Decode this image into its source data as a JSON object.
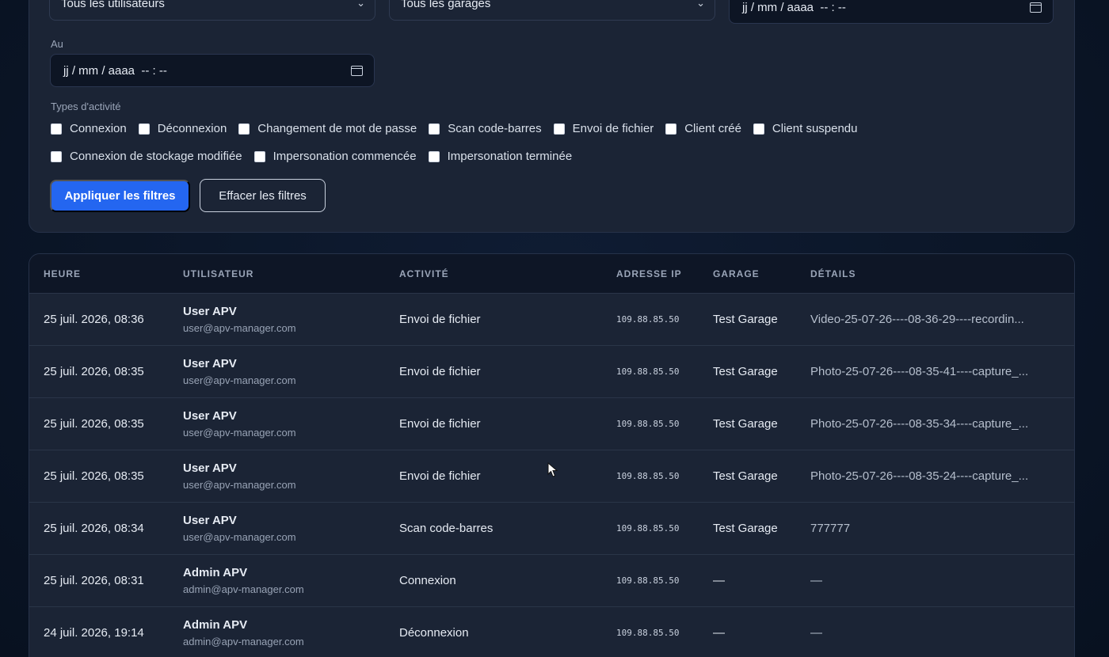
{
  "filters": {
    "user_select": "Tous les utilisateurs",
    "garage_select": "Tous les garages",
    "date_from": "jj / mm / aaaa  -- : --",
    "date_to_label": "Au",
    "date_to": "jj / mm / aaaa  -- : --",
    "types_label": "Types d'activité",
    "types_row1": [
      "Connexion",
      "Déconnexion",
      "Changement de mot de passe",
      "Scan code-barres",
      "Envoi de fichier",
      "Client créé",
      "Client suspendu"
    ],
    "types_row2": [
      "Connexion de stockage modifiée",
      "Impersonation commencée",
      "Impersonation terminée"
    ],
    "apply_label": "Appliquer les filtres",
    "clear_label": "Effacer les filtres"
  },
  "table": {
    "headers": [
      "HEURE",
      "UTILISATEUR",
      "ACTIVITÉ",
      "ADRESSE IP",
      "GARAGE",
      "DÉTAILS"
    ],
    "rows": [
      {
        "time": "25 juil. 2026, 08:36",
        "user": "User APV",
        "email": "user@apv-manager.com",
        "activity": "Envoi de fichier",
        "ip": "109.88.85.50",
        "garage": "Test Garage",
        "details": "Video-25-07-26----08-36-29----recordin..."
      },
      {
        "time": "25 juil. 2026, 08:35",
        "user": "User APV",
        "email": "user@apv-manager.com",
        "activity": "Envoi de fichier",
        "ip": "109.88.85.50",
        "garage": "Test Garage",
        "details": "Photo-25-07-26----08-35-41----capture_..."
      },
      {
        "time": "25 juil. 2026, 08:35",
        "user": "User APV",
        "email": "user@apv-manager.com",
        "activity": "Envoi de fichier",
        "ip": "109.88.85.50",
        "garage": "Test Garage",
        "details": "Photo-25-07-26----08-35-34----capture_..."
      },
      {
        "time": "25 juil. 2026, 08:35",
        "user": "User APV",
        "email": "user@apv-manager.com",
        "activity": "Envoi de fichier",
        "ip": "109.88.85.50",
        "garage": "Test Garage",
        "details": "Photo-25-07-26----08-35-24----capture_..."
      },
      {
        "time": "25 juil. 2026, 08:34",
        "user": "User APV",
        "email": "user@apv-manager.com",
        "activity": "Scan code-barres",
        "ip": "109.88.85.50",
        "garage": "Test Garage",
        "details": "777777"
      },
      {
        "time": "25 juil. 2026, 08:31",
        "user": "Admin APV",
        "email": "admin@apv-manager.com",
        "activity": "Connexion",
        "ip": "109.88.85.50",
        "garage": "—",
        "details": "—"
      },
      {
        "time": "24 juil. 2026, 19:14",
        "user": "Admin APV",
        "email": "admin@apv-manager.com",
        "activity": "Déconnexion",
        "ip": "109.88.85.50",
        "garage": "—",
        "details": "—"
      }
    ]
  },
  "colors": {
    "accent": "#2466f0",
    "panel": "#1b2435",
    "background": "#0b1628"
  }
}
